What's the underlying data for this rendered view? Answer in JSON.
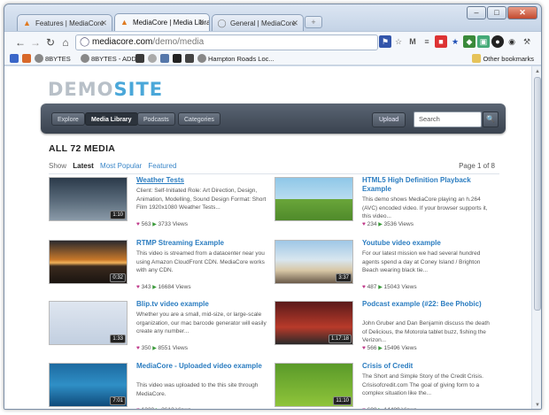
{
  "browser": {
    "tabs": [
      {
        "title": "Features | MediaCore",
        "active": false
      },
      {
        "title": "MediaCore | Media Library",
        "active": true
      },
      {
        "title": "General | MediaCore",
        "active": false
      }
    ],
    "url_host": "mediacore.com",
    "url_path": "/demo/media",
    "bookmarks": [
      "8BYTES",
      "8BYTES - ADD",
      "Hampton Roads Loc..."
    ],
    "other_bookmarks": "Other bookmarks"
  },
  "site": {
    "logo_part1": "DEMO",
    "logo_part2": "SITE",
    "nav": [
      "Explore",
      "Media Library",
      "Podcasts",
      "Categories"
    ],
    "active_nav": "Media Library",
    "upload_label": "Upload",
    "search_placeholder": "Search",
    "heading": "ALL 72 MEDIA",
    "show_label": "Show",
    "sort_options": [
      "Latest",
      "Most Popular",
      "Featured"
    ],
    "page_info": "Page 1 of 8",
    "views_suffix": "Views"
  },
  "media": [
    {
      "title": "Weather Tests",
      "desc": "Client: Self-Initiated Role: Art Direction, Design, Animation, Modelling, Sound Design Format: Short Film 1920x1080 Weather Tests...",
      "likes": "563",
      "views": "3733",
      "duration": "1:10",
      "thumb": "weather"
    },
    {
      "title": "HTML5 High Definition Playback Example",
      "desc": "This demo shows MediaCore playing an h.264 (AVC) encoded video. If your browser supports it, this video...",
      "likes": "234",
      "views": "3536",
      "duration": "",
      "thumb": "bunny"
    },
    {
      "title": "RTMP Streaming Example",
      "desc": "This video is streamed from a datacenter near you using Amazon CloudFront CDN. MediaCore works with any CDN.",
      "likes": "343",
      "views": "16684",
      "duration": "0:32",
      "thumb": "sunset"
    },
    {
      "title": "Youtube video example",
      "desc": "For our latest mission we had several hundred agents spend a day at Coney Island / Brighton Beach wearing black tie...",
      "likes": "487",
      "views": "15043",
      "duration": "3:37",
      "thumb": "beach"
    },
    {
      "title": "Blip.tv video example",
      "desc": "Whether you are a small, mid-size, or large-scale organization, our mac barcode generator will easily create any number...",
      "likes": "350",
      "views": "8551",
      "duration": "1:33",
      "thumb": "barcode"
    },
    {
      "title": "Podcast example (#22: Bee Phobic)",
      "desc": "John Gruber and Dan Benjamin discuss the death of Delicious, the Motorola tablet buzz, fishing the Verizon...",
      "likes": "566",
      "views": "15496",
      "duration": "1:17:18",
      "thumb": "talkshow"
    },
    {
      "title": "MediaCore - Uploaded video example",
      "desc": "This video was uploaded to the this site through MediaCore.",
      "likes": "1230",
      "views": "3612",
      "duration": "7:01",
      "thumb": "shark"
    },
    {
      "title": "Crisis of Credit",
      "desc": "The Short and Simple Story of the Credit Crisis. Crisisofcredit.com The goal of giving form to a complex situation like the...",
      "likes": "608",
      "views": "14489",
      "duration": "11:10",
      "thumb": "credit"
    }
  ]
}
